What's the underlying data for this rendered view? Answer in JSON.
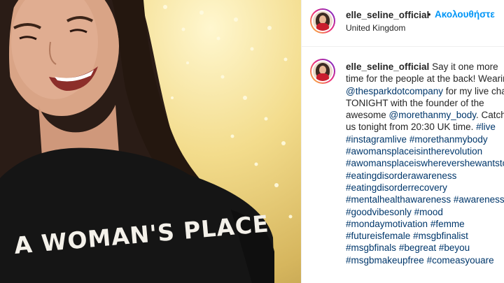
{
  "post": {
    "header": {
      "username": "elle_seline_official",
      "separator": "•",
      "follow_label": "Ακολουθήστε",
      "location": "United Kingdom"
    },
    "caption": {
      "username": "elle_seline_official",
      "segments": [
        {
          "type": "text",
          "value": " Say it one more time for the people at the back! Wearing "
        },
        {
          "type": "link",
          "value": "@thesparkdotcompany"
        },
        {
          "type": "text",
          "value": " for my live chat TONIGHT with the founder of the awesome "
        },
        {
          "type": "link",
          "value": "@morethanmy_body"
        },
        {
          "type": "text",
          "value": ". Catch us tonight from 20:30 UK time. "
        },
        {
          "type": "link",
          "value": "#live"
        },
        {
          "type": "text",
          "value": " "
        },
        {
          "type": "link",
          "value": "#instagramlive"
        },
        {
          "type": "text",
          "value": " "
        },
        {
          "type": "link",
          "value": "#morethanmybody"
        },
        {
          "type": "text",
          "value": " "
        },
        {
          "type": "link",
          "value": "#awomansplaceisintherevolution"
        },
        {
          "type": "text",
          "value": " "
        },
        {
          "type": "link",
          "value": "#awomansplaceiswherevershewantstobe"
        },
        {
          "type": "text",
          "value": " "
        },
        {
          "type": "link",
          "value": "#eatingdisorderawareness"
        },
        {
          "type": "text",
          "value": " "
        },
        {
          "type": "link",
          "value": "#eatingdisorderrecovery"
        },
        {
          "type": "text",
          "value": " "
        },
        {
          "type": "link",
          "value": "#mentalhealthawareness"
        },
        {
          "type": "text",
          "value": " "
        },
        {
          "type": "link",
          "value": "#awareness"
        },
        {
          "type": "text",
          "value": " "
        },
        {
          "type": "link",
          "value": "#goodvibesonly"
        },
        {
          "type": "text",
          "value": " "
        },
        {
          "type": "link",
          "value": "#mood"
        },
        {
          "type": "text",
          "value": " "
        },
        {
          "type": "link",
          "value": "#mondaymotivation"
        },
        {
          "type": "text",
          "value": " "
        },
        {
          "type": "link",
          "value": "#femme"
        },
        {
          "type": "text",
          "value": " "
        },
        {
          "type": "link",
          "value": "#futureisfemale"
        },
        {
          "type": "text",
          "value": " "
        },
        {
          "type": "link",
          "value": "#msgbfinalist"
        },
        {
          "type": "text",
          "value": " "
        },
        {
          "type": "link",
          "value": "#msgbfinals"
        },
        {
          "type": "text",
          "value": " "
        },
        {
          "type": "link",
          "value": "#begreat"
        },
        {
          "type": "text",
          "value": " "
        },
        {
          "type": "link",
          "value": "#beyou"
        },
        {
          "type": "text",
          "value": " "
        },
        {
          "type": "link",
          "value": "#msgbmakeupfree"
        },
        {
          "type": "text",
          "value": " "
        },
        {
          "type": "link",
          "value": "#comeasyouare"
        }
      ]
    },
    "photo": {
      "shirt_text": "A WOMAN'S PLACE"
    }
  },
  "colors": {
    "link": "#00376b",
    "follow": "#0095f6",
    "text": "#262626",
    "shirt": "#151515"
  },
  "icons": [
    "profile-avatar-icon"
  ]
}
